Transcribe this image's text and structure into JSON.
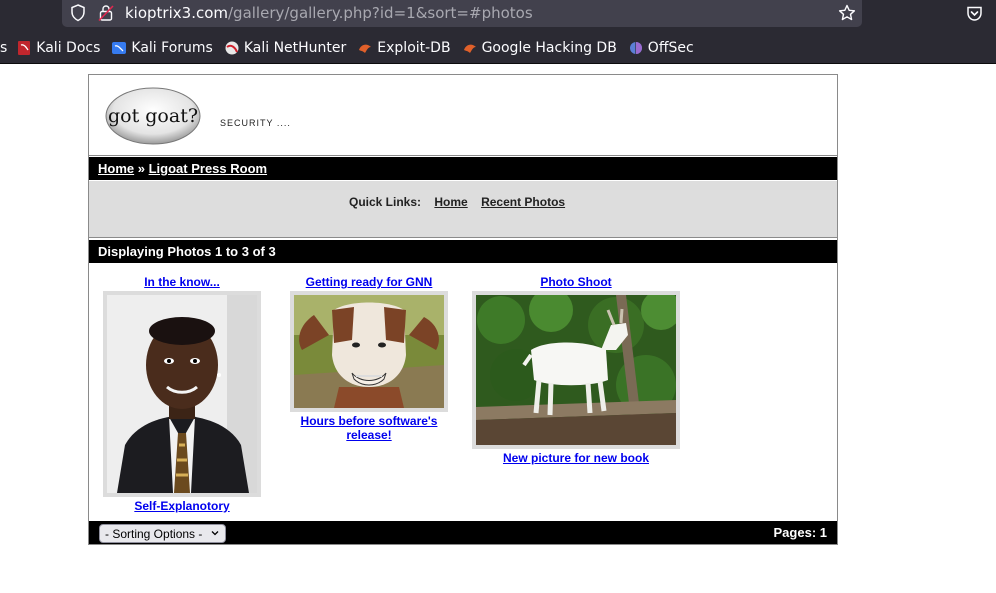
{
  "browser": {
    "url_host": "kioptrix3.com",
    "url_path": "/gallery/gallery.php?id=1&sort=#photos",
    "bookmarks": [
      {
        "label": "Kali Docs",
        "icon": "kali-docs-icon"
      },
      {
        "label": "Kali Forums",
        "icon": "kali-forums-icon"
      },
      {
        "label": "Kali NetHunter",
        "icon": "kali-nethunter-icon"
      },
      {
        "label": "Exploit-DB",
        "icon": "exploit-db-icon"
      },
      {
        "label": "Google Hacking DB",
        "icon": "ghdb-icon"
      },
      {
        "label": "OffSec",
        "icon": "offsec-icon"
      }
    ],
    "bookmark_cut": "s"
  },
  "header": {
    "logo_text": "got goat?",
    "tagline": "SECURITY ...."
  },
  "breadcrumb": {
    "home": "Home",
    "separator": "»",
    "current": "Ligoat Press Room"
  },
  "quicklinks": {
    "label": "Quick Links:",
    "home": "Home",
    "recent": "Recent Photos"
  },
  "gallery": {
    "heading": "Displaying Photos 1 to 3 of 3",
    "photos": [
      {
        "title": "In the know...",
        "caption": "Self-Explanotory"
      },
      {
        "title": "Getting ready for GNN",
        "caption": "Hours before software's release!"
      },
      {
        "title": "Photo Shoot",
        "caption": "New picture for new book"
      }
    ]
  },
  "footer": {
    "sort_label": "- Sorting Options -",
    "pages": "Pages: 1"
  },
  "colors": {
    "chrome_bg": "#2b2a33",
    "bar_bg": "#000000",
    "quicklinks_bg": "#dddddd"
  }
}
